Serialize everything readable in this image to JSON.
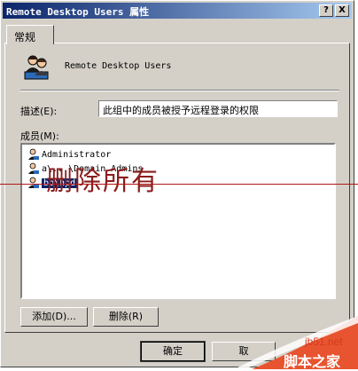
{
  "titlebar": {
    "title": "Remote Desktop Users 属性",
    "help_label": "?",
    "close_label": "X"
  },
  "tabs": [
    {
      "label": "常规"
    }
  ],
  "group": {
    "name": "Remote Desktop Users"
  },
  "description": {
    "label": "描述(E):",
    "value": "此组中的成员被授予远程登录的权限"
  },
  "members": {
    "label": "成员(M):",
    "items": [
      {
        "text": "Administrator",
        "selected": false
      },
      {
        "text": "a\\...\\Domain Admins",
        "selected": false
      },
      {
        "text": "bb\\hpd",
        "selected": true
      }
    ]
  },
  "buttons": {
    "add": "添加(D)...",
    "remove": "删除(R)",
    "ok": "确定",
    "cancel": "取"
  },
  "overlay": {
    "watermark": "删除所有",
    "site_url": "jb51.net",
    "site_name": "脚本之家"
  },
  "colors": {
    "title_start": "#0a246a",
    "title_end": "#a6caf0",
    "selection": "#0a246a",
    "watermark": "#8b1c1c",
    "corner": "#e8542f"
  }
}
